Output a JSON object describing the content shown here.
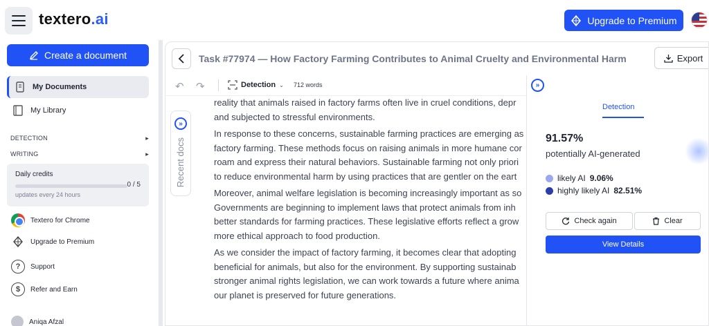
{
  "header": {
    "logo_main": "textero",
    "logo_suffix": ".ai",
    "upgrade_label": "Upgrade to Premium",
    "flag_icon": "us-flag-icon"
  },
  "sidebar": {
    "create_label": "Create a document",
    "nav": [
      {
        "label": "My Documents",
        "icon": "document-icon",
        "active": true
      },
      {
        "label": "My Library",
        "icon": "library-icon",
        "active": false
      }
    ],
    "sections": [
      {
        "label": "DETECTION"
      },
      {
        "label": "WRITING"
      }
    ],
    "credits": {
      "label": "Daily credits",
      "count": "0 / 5",
      "used_fraction": 0,
      "note": "updates every 24 hours"
    },
    "links": [
      {
        "label": "Textero for Chrome",
        "icon": "chrome-icon"
      },
      {
        "label": "Upgrade to Premium",
        "icon": "diamond-icon"
      },
      {
        "label": "Support",
        "icon": "question-icon"
      },
      {
        "label": "Refer and Earn",
        "icon": "dollar-icon"
      }
    ],
    "user_name": "Aniqa Afzal"
  },
  "main": {
    "task_title": "Task #77974 — How Factory Farming Contributes to Animal Cruelty and Environmental Harm",
    "export_label": "Export",
    "toolbar": {
      "mode_label": "Detection",
      "word_count": "712 words"
    },
    "recent_docs_label": "Recent docs",
    "paragraphs": [
      [
        "reality that animals raised in factory farms often live in cruel conditions, depr",
        "and subjected to stressful environments."
      ],
      [
        "In response to these concerns, sustainable farming practices are emerging as",
        "factory farming. These methods focus on raising animals in more humane cor",
        "roam and express their natural behaviors. Sustainable farming not only priori",
        "to reduce environmental harm by using practices that are gentler on the eart"
      ],
      [
        "Moreover, animal welfare legislation is becoming increasingly important as so",
        "Governments are beginning to implement laws that protect animals from inh",
        "better standards for farming practices. These legislative efforts reflect a grow",
        "more ethical approach to food production."
      ],
      [
        "As we consider the impact of factory farming, it becomes clear that adopting",
        "beneficial for animals, but also for the environment. By supporting sustainab",
        "stronger animal rights legislation, we can work towards a future where anima",
        "our planet is preserved for future generations."
      ]
    ]
  },
  "panel": {
    "tab_label": "Detection",
    "score": "91.57%",
    "score_label": "potentially AI-generated",
    "legend": [
      {
        "label": "likely AI",
        "value": "9.06%",
        "color": "#9aa8f0"
      },
      {
        "label": "highly likely AI",
        "value": "82.51%",
        "color": "#2b3ea8"
      }
    ],
    "check_again_label": "Check again",
    "clear_label": "Clear",
    "view_details_label": "View Details"
  }
}
